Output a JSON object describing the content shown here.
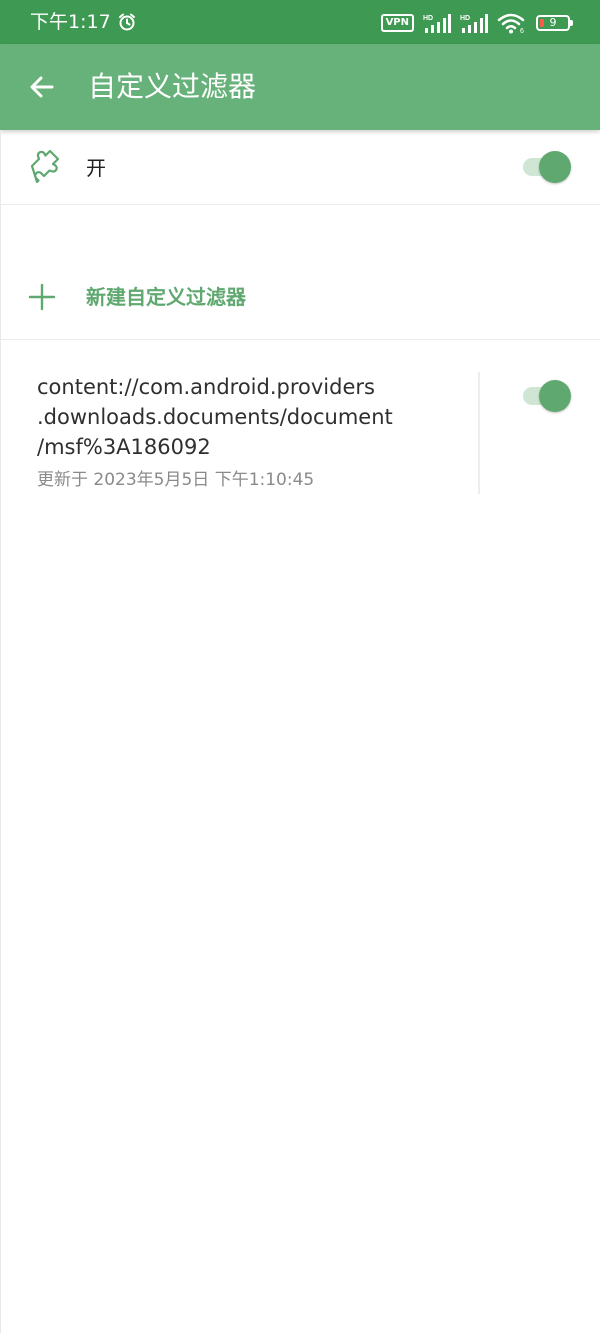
{
  "status_bar": {
    "time": "下午1:17",
    "alarm_icon": "alarm-icon",
    "vpn": "VPN",
    "hd_1": "HD",
    "hd_2": "HD",
    "wifi_icon": "wifi-icon",
    "wifi_badge": "6",
    "battery": "9",
    "battery_fill_color": "#ff5a4e"
  },
  "app_bar": {
    "title": "自定义过滤器",
    "back_icon": "arrow-back-icon",
    "color": "#67b17a"
  },
  "master_switch": {
    "icon": "puzzle-icon",
    "label": "开",
    "on": true
  },
  "new_filter": {
    "icon": "plus-icon",
    "label": "新建自定义过滤器"
  },
  "filters": [
    {
      "uri_lines": [
        "content://com.android.providers",
        ".downloads.documents/document",
        "/msf%3A186092"
      ],
      "updated": "更新于 2023年5月5日 下午1:10:45",
      "enabled": true
    }
  ],
  "colors": {
    "status_bar": "#3e9a52",
    "accent": "#5fa870",
    "track": "#cfe6d5"
  }
}
